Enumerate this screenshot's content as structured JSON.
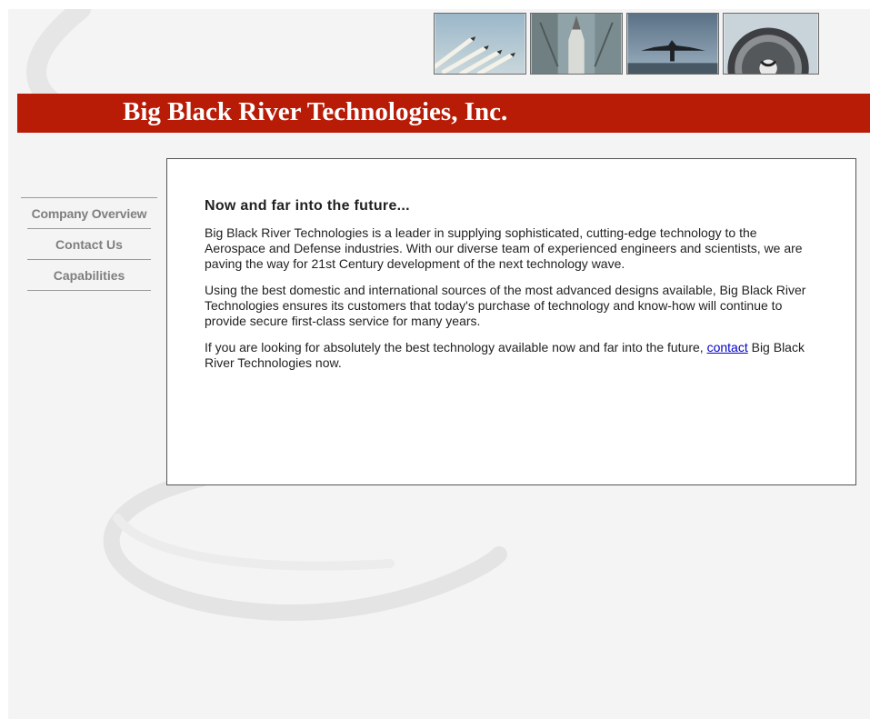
{
  "header": {
    "title": "Big Black River Technologies, Inc.",
    "photos": [
      {
        "name": "formation-jets-photo"
      },
      {
        "name": "rocket-launch-photo"
      },
      {
        "name": "aircraft-photo"
      },
      {
        "name": "jet-engine-photo"
      }
    ]
  },
  "nav": {
    "items": [
      {
        "label": "Company Overview"
      },
      {
        "label": "Contact Us"
      },
      {
        "label": "Capabilities"
      }
    ]
  },
  "content": {
    "heading": "Now and far into the future...",
    "paragraph1": "Big Black River Technologies is a leader in supplying sophisticated, cutting-edge technology to the Aerospace and Defense industries. With our diverse team of experienced engineers and scientists, we are paving the way for 21st Century development of the next technology wave.",
    "paragraph2": "Using the best domestic and international sources of the most advanced designs available, Big Black River Technologies ensures its customers that today's purchase of technology and know-how will continue to provide secure first-class service for many years.",
    "paragraph3_prefix": "If you are looking for absolutely the best technology available now and far into the future, ",
    "paragraph3_link": "contact",
    "paragraph3_suffix": " Big Black River Technologies now."
  },
  "colors": {
    "banner": "#b81c07",
    "background": "#f4f4f4",
    "nav_text": "#7f7f7f",
    "link": "#0000cc"
  }
}
